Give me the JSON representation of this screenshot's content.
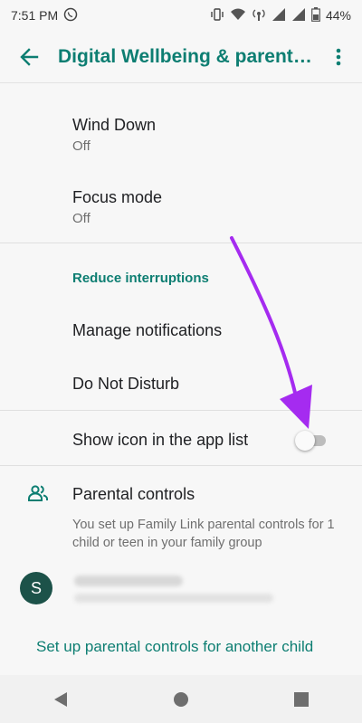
{
  "status": {
    "time": "7:51 PM",
    "battery": "44%"
  },
  "appbar": {
    "title": "Digital Wellbeing & parental controls"
  },
  "items": {
    "wind_down": {
      "title": "Wind Down",
      "subtitle": "Off"
    },
    "focus_mode": {
      "title": "Focus mode",
      "subtitle": "Off"
    },
    "section_header": "Reduce interruptions",
    "manage_notifications": "Manage notifications",
    "do_not_disturb": "Do Not Disturb",
    "show_icon": {
      "label": "Show icon in the app list",
      "enabled": false
    }
  },
  "parental": {
    "title": "Parental controls",
    "description": "You set up Family Link parental controls for 1 child or teen in your family group",
    "account_initial": "S",
    "setup_link": "Set up parental controls for another child"
  },
  "colors": {
    "accent": "#0d7e72",
    "annotation_arrow": "#a52bf0"
  },
  "icons": [
    "whatsapp-icon",
    "vibrate-icon",
    "wifi-icon",
    "signal-icon",
    "battery-icon",
    "back-arrow-icon",
    "more-vert-icon",
    "parental-controls-icon",
    "nav-back-icon",
    "nav-home-icon",
    "nav-recents-icon"
  ]
}
